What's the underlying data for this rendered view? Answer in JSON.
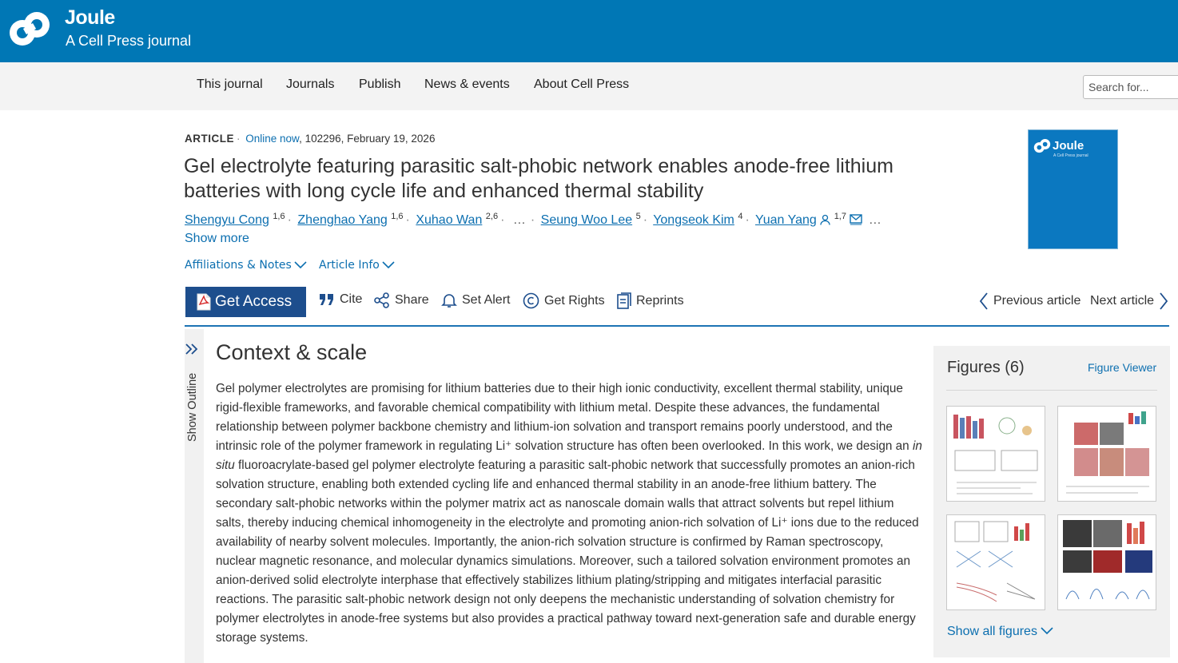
{
  "header": {
    "brand_name": "Joule",
    "brand_sub": "A Cell Press journal",
    "bar_color": "#0077b5"
  },
  "nav": {
    "items": [
      "This journal",
      "Journals",
      "Publish",
      "News & events",
      "About Cell Press"
    ],
    "search_placeholder": "Search for..."
  },
  "article": {
    "type": "ARTICLE",
    "online": "Online now",
    "citation": "102296, February 19, 2026",
    "title": "Gel electrolyte featuring parasitic salt-phobic network enables anode-free lithium batteries with long cycle life and enhanced thermal stability",
    "authors": [
      {
        "name": "Shengyu Cong",
        "aff": "1,6"
      },
      {
        "name": "Zhenghao Yang",
        "aff": "1,6"
      },
      {
        "name": "Xuhao Wan",
        "aff": "2,6"
      },
      {
        "name": "Seung Woo Lee",
        "aff": "5"
      },
      {
        "name": "Yongseok Kim",
        "aff": "4"
      },
      {
        "name": "Yuan Yang",
        "aff": "1,7"
      }
    ],
    "ellipsis": "…",
    "show_more": "Show more",
    "affiliations_label": "Affiliations & Notes",
    "article_info_label": "Article Info",
    "cover": {
      "title": "Joule",
      "subtitle": "A Cell Press journal"
    }
  },
  "toolbar": {
    "get_access": "Get Access",
    "cite": "Cite",
    "share": "Share",
    "set_alert": "Set Alert",
    "get_rights": "Get Rights",
    "reprints": "Reprints",
    "previous": "Previous article",
    "next": "Next article",
    "accent": "#1d4e8d"
  },
  "outline": {
    "label": "Show Outline"
  },
  "content": {
    "section_title": "Context & scale",
    "para_before_em": "Gel polymer electrolytes are promising for lithium batteries due to their high ionic conductivity, excellent thermal stability, unique rigid-flexible frameworks, and favorable chemical compatibility with lithium metal. Despite these advances, the fundamental relationship between polymer backbone chemistry and lithium-ion solvation and transport remains poorly understood, and the intrinsic role of the polymer framework in regulating Li⁺ solvation structure has often been overlooked. In this work, we design an ",
    "para_em": "in situ",
    "para_after_em": " fluoroacrylate-based gel polymer electrolyte featuring a parasitic salt-phobic network that successfully promotes an anion-rich solvation structure, enabling both extended cycling life and enhanced thermal stability in an anode-free lithium battery. The secondary salt-phobic networks within the polymer matrix act as nanoscale domain walls that attract solvents but repel lithium salts, thereby inducing chemical inhomogeneity in the electrolyte and promoting anion-rich solvation of Li⁺ ions due to the reduced availability of nearby solvent molecules. Importantly, the anion-rich solvation structure is confirmed by Raman spectroscopy, nuclear magnetic resonance, and molecular dynamics simulations. Moreover, such a tailored solvation environment promotes an anion-derived solid electrolyte interphase that effectively stabilizes lithium plating/stripping and mitigates interfacial parasitic reactions. The parasitic salt-phobic network design not only deepens the mechanistic understanding of solvation chemistry for polymer electrolytes in anode-free systems but also provides a practical pathway toward next-generation safe and durable energy storage systems."
  },
  "figures": {
    "heading": "Figures (6)",
    "viewer": "Figure Viewer",
    "show_all": "Show all figures"
  }
}
